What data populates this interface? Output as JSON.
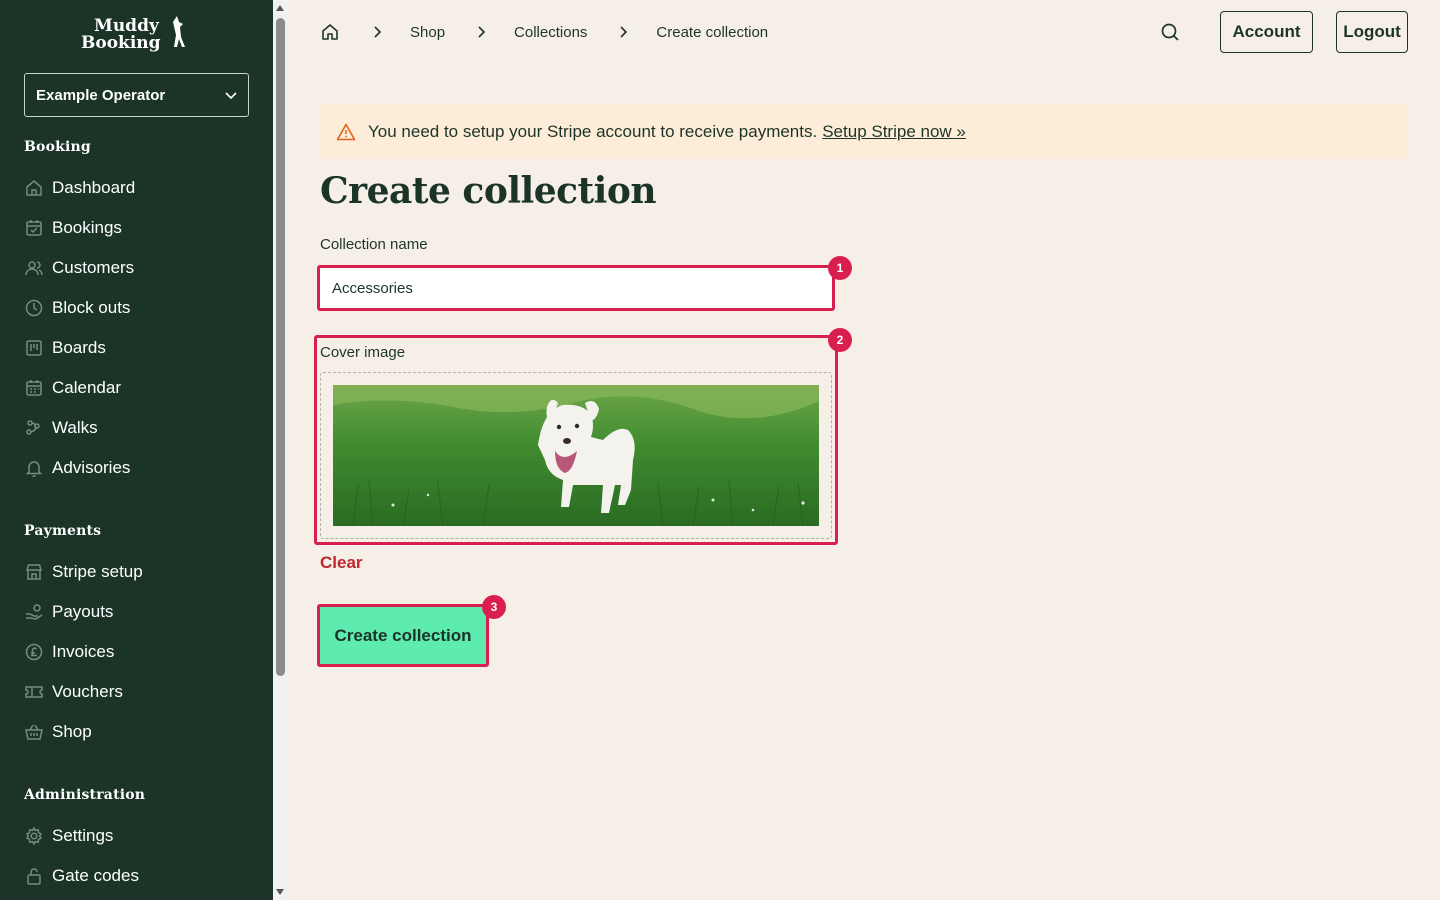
{
  "brand": {
    "logo_text": [
      "Muddy",
      "Booking"
    ]
  },
  "sidebar": {
    "operator": "Example Operator",
    "sections": [
      {
        "title": "Booking",
        "items": [
          {
            "label": "Dashboard",
            "icon": "home-icon"
          },
          {
            "label": "Bookings",
            "icon": "calendar-check-icon"
          },
          {
            "label": "Customers",
            "icon": "users-icon"
          },
          {
            "label": "Block outs",
            "icon": "clock-icon"
          },
          {
            "label": "Boards",
            "icon": "board-icon"
          },
          {
            "label": "Calendar",
            "icon": "calendar-icon"
          },
          {
            "label": "Walks",
            "icon": "paw-icon"
          },
          {
            "label": "Advisories",
            "icon": "bell-icon"
          }
        ]
      },
      {
        "title": "Payments",
        "items": [
          {
            "label": "Stripe setup",
            "icon": "store-icon"
          },
          {
            "label": "Payouts",
            "icon": "hand-coins-icon"
          },
          {
            "label": "Invoices",
            "icon": "pound-icon"
          },
          {
            "label": "Vouchers",
            "icon": "ticket-icon"
          },
          {
            "label": "Shop",
            "icon": "basket-icon"
          }
        ]
      },
      {
        "title": "Administration",
        "items": [
          {
            "label": "Settings",
            "icon": "gear-icon"
          },
          {
            "label": "Gate codes",
            "icon": "lock-icon"
          }
        ]
      }
    ]
  },
  "breadcrumb": [
    "Shop",
    "Collections",
    "Create collection"
  ],
  "header": {
    "account": "Account",
    "logout": "Logout"
  },
  "banner": {
    "message": "You need to setup your Stripe account to receive payments.",
    "link": "Setup Stripe now »"
  },
  "page": {
    "title": "Create collection",
    "name_label": "Collection name",
    "name_value": "Accessories",
    "cover_label": "Cover image",
    "clear": "Clear",
    "submit": "Create collection"
  },
  "markers": [
    "1",
    "2",
    "3"
  ],
  "colors": {
    "sidebar": "#1b3427",
    "background": "#f6efe8",
    "accent": "#5eebb0",
    "marker": "#d81f4e",
    "banner": "#fdecd7"
  }
}
